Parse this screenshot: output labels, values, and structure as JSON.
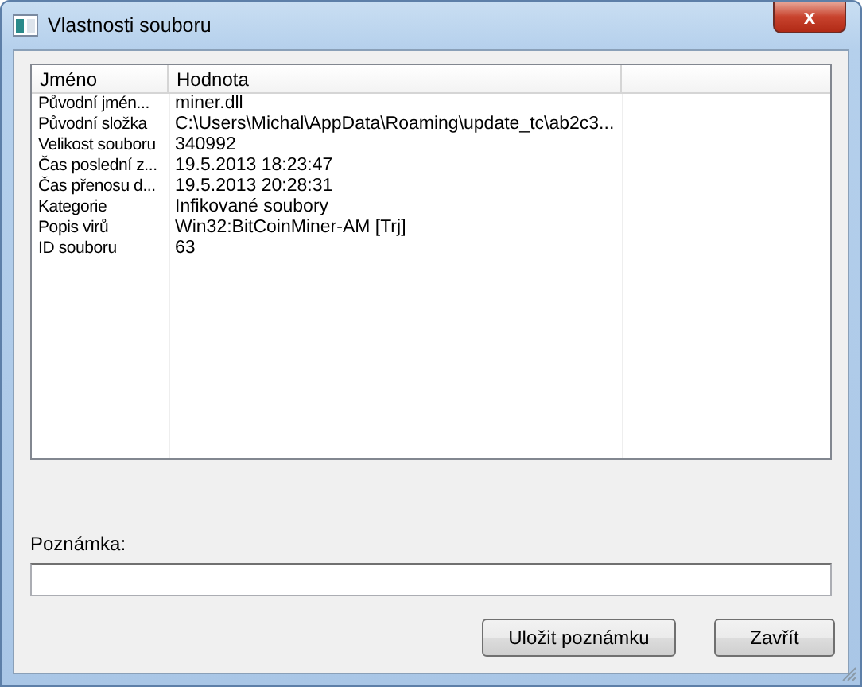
{
  "window": {
    "title": "Vlastnosti souboru",
    "close_label": "x"
  },
  "table": {
    "columns": [
      "Jméno",
      "Hodnota"
    ],
    "rows": [
      {
        "name": "Původní jmén...",
        "value": "miner.dll"
      },
      {
        "name": "Původní složka",
        "value": "C:\\Users\\Michal\\AppData\\Roaming\\update_tc\\ab2c3..."
      },
      {
        "name": "Velikost souboru",
        "value": "340992"
      },
      {
        "name": "Čas poslední z...",
        "value": "19.5.2013 18:23:47"
      },
      {
        "name": "Čas přenosu d...",
        "value": "19.5.2013 20:28:31"
      },
      {
        "name": "Kategorie",
        "value": "Infikované soubory"
      },
      {
        "name": "Popis virů",
        "value": "Win32:BitCoinMiner-AM [Trj]"
      },
      {
        "name": "ID souboru",
        "value": "63"
      }
    ]
  },
  "note": {
    "label": "Poznámka:"
  },
  "buttons": [
    "Uložit poznámku",
    "Zavřít"
  ]
}
